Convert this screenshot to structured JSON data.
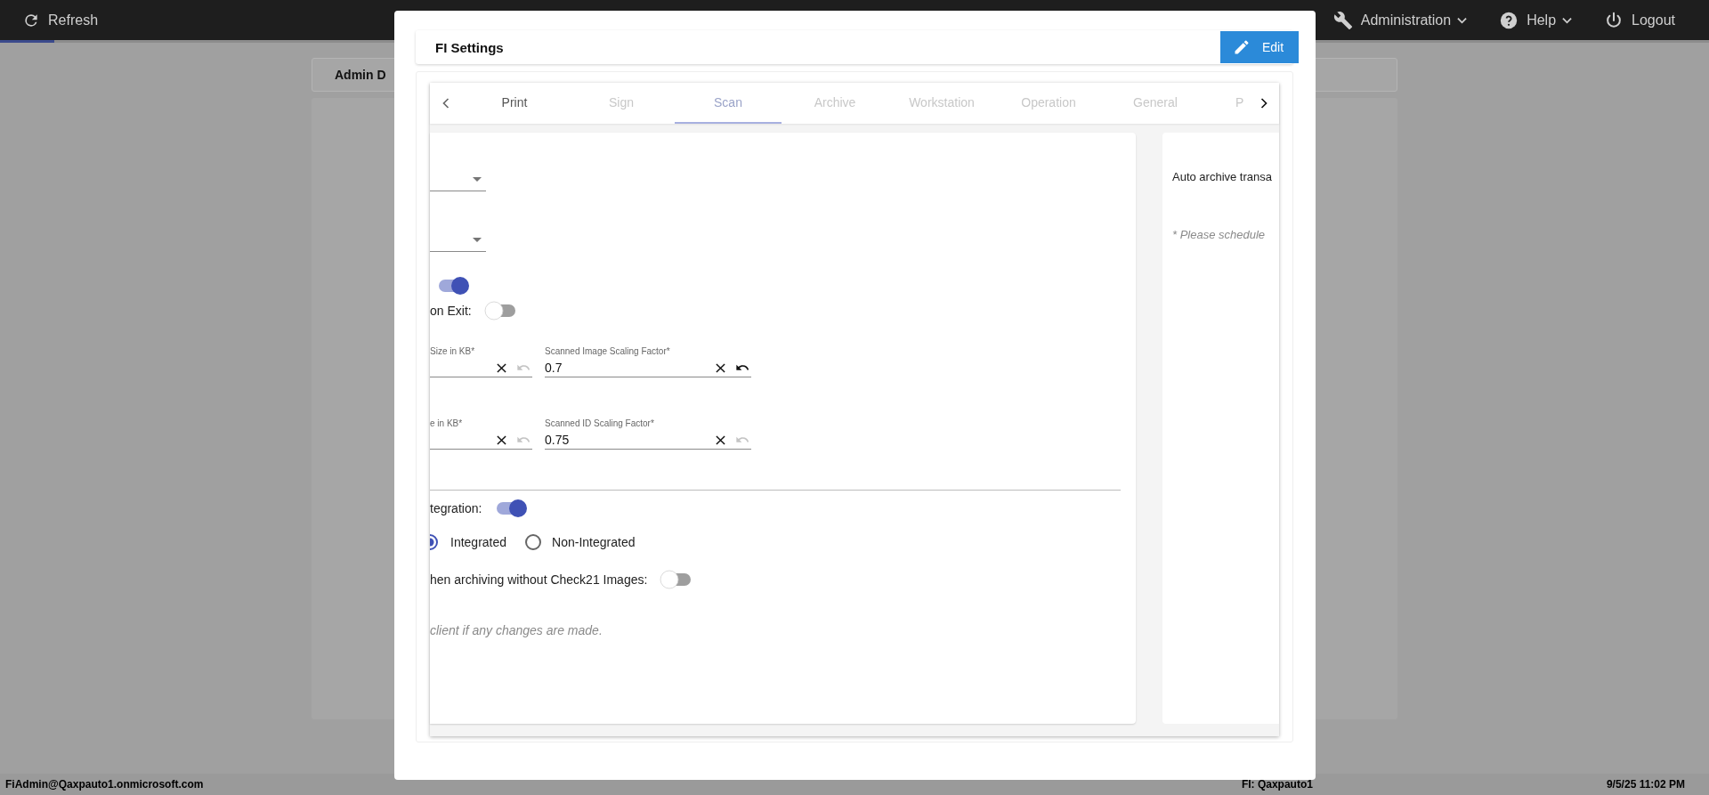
{
  "top_bar": {
    "refresh": "Refresh",
    "menus": [
      {
        "label": "Administration",
        "dropdown": true
      },
      {
        "label": "Help",
        "dropdown": true
      },
      {
        "label": "Logout",
        "dropdown": false
      }
    ]
  },
  "page": {
    "card_title": "Admin D"
  },
  "status_bar": {
    "user": "FiAdmin@Qaxpauto1.onmicrosoft.com",
    "fi": "FI: Qaxpauto1",
    "datetime": "9/5/25 11:02 PM"
  },
  "dialog": {
    "title": "FI Settings",
    "edit_button": "Edit",
    "tabs": [
      {
        "label": "Print",
        "selected": false,
        "dimmed": false
      },
      {
        "label": "Sign",
        "selected": false,
        "dimmed": true
      },
      {
        "label": "Scan",
        "selected": true,
        "dimmed": true
      },
      {
        "label": "Archive",
        "selected": false,
        "dimmed": true
      },
      {
        "label": "Workstation",
        "selected": false,
        "dimmed": true
      },
      {
        "label": "Operation",
        "selected": false,
        "dimmed": true
      },
      {
        "label": "General",
        "selected": false,
        "dimmed": true
      },
      {
        "label": "P",
        "selected": false,
        "dimmed": true
      }
    ],
    "left_panel": {
      "rows": [
        {
          "kind": "dropdown"
        },
        {
          "kind": "dropdown"
        },
        {
          "kind": "toggle",
          "on": true
        },
        {
          "kind": "toggle",
          "label": "on Exit:",
          "on": false
        },
        {
          "kind": "fields",
          "fields": [
            {
              "label": "Size in KB*",
              "undo_enabled": false
            },
            {
              "label": "Scanned Image Scaling Factor*",
              "value": "0.7",
              "undo_enabled": true
            }
          ]
        },
        {
          "kind": "fields",
          "fields": [
            {
              "label": "e in KB*",
              "undo_enabled": false
            },
            {
              "label": "Scanned ID Scaling Factor*",
              "value": "0.75",
              "undo_enabled": false
            }
          ]
        },
        {
          "kind": "divider"
        },
        {
          "kind": "toggle",
          "label": "tegration:",
          "on": true
        },
        {
          "kind": "radios",
          "options": [
            {
              "label": "Integrated",
              "selected": true
            },
            {
              "label": "Non-Integrated",
              "selected": false
            }
          ]
        },
        {
          "kind": "toggle",
          "label": "hen archiving without Check21 Images:",
          "on": false
        },
        {
          "kind": "note",
          "text": "client if any changes are made."
        }
      ]
    },
    "right_panel": {
      "text": "Auto archive transa",
      "note": "* Please schedule"
    }
  }
}
